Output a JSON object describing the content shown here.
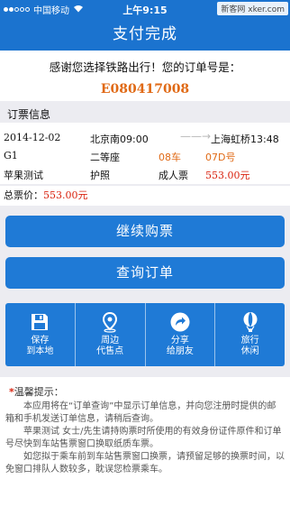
{
  "status_bar": {
    "carrier": "中国移动",
    "time": "上午9:15",
    "watermark": "新客网 xker.com"
  },
  "nav": {
    "title": "支付完成"
  },
  "thanks": {
    "message": "感谢您选择铁路出行！您的订单号是：",
    "order_no": "E080417008"
  },
  "ticket_info": {
    "section_title": "订票信息",
    "date": "2014-12-02",
    "from": "北京南09:00",
    "arrow": "——→",
    "to": "上海虹桥13:48",
    "train": "G1",
    "seat_class": "二等座",
    "car": "08车",
    "seat": "07D号",
    "passenger": "苹果测试",
    "id_type": "护照",
    "ticket_type": "成人票",
    "price": "553.00元"
  },
  "total": {
    "label": "总票价：",
    "value": "553.00元"
  },
  "buttons": {
    "continue": "继续购票",
    "query": "查询订单"
  },
  "quick_links": [
    {
      "line1": "保存",
      "line2": "到本地",
      "icon": "save-icon"
    },
    {
      "line1": "周边",
      "line2": "代售点",
      "icon": "map-pin-icon"
    },
    {
      "line1": "分享",
      "line2": "给朋友",
      "icon": "share-icon"
    },
    {
      "line1": "旅行",
      "line2": "休闲",
      "icon": "balloon-icon"
    }
  ],
  "tips": {
    "star": "*",
    "title": "温馨提示：",
    "paragraphs": [
      "本应用将在“订单查询”中显示订单信息，并向您注册时提供的邮箱和手机发送订单信息，请稍后查询。",
      "苹果测试 女士/先生请持购票时所使用的有效身份证件原件和订单号尽快到车站售票窗口换取纸质车票。",
      "如您拟于乘车前到车站售票窗口换票，请预留足够的换票时间，以免窗口排队人数较多，耽误您检票乘车。"
    ]
  }
}
